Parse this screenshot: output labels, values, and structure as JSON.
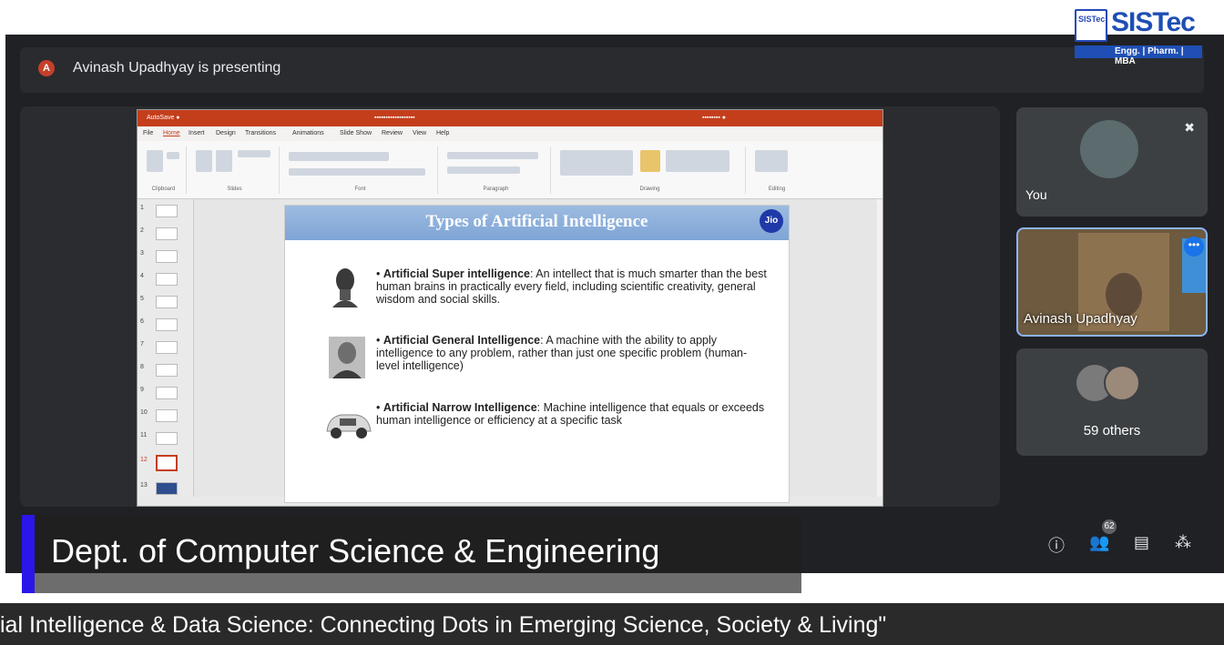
{
  "meet": {
    "presenting_initial": "A",
    "presenting_text": "Avinash Upadhyay is presenting"
  },
  "logo": {
    "badge": "SISTec",
    "name": "SISTec",
    "tagline": "Engg. | Pharm. | MBA"
  },
  "ppt": {
    "tabs": [
      "File",
      "Home",
      "Insert",
      "Design",
      "Transitions",
      "Animations",
      "Slide Show",
      "Review",
      "View",
      "Help"
    ],
    "ribbon_groups": [
      "Clipboard",
      "Slides",
      "Font",
      "Paragraph",
      "Drawing",
      "Editing"
    ],
    "thumb_numbers": [
      "1",
      "2",
      "3",
      "4",
      "5",
      "6",
      "7",
      "8",
      "9",
      "10",
      "11",
      "12",
      "13"
    ],
    "active_thumb": "12"
  },
  "slide": {
    "title": "Types of Artificial Intelligence",
    "logo": "Jio",
    "bullets": [
      {
        "term": "Artificial Super intelligence",
        "text": ": An intellect that is much smarter than the best human brains in practically every field, including scientific creativity, general wisdom and social skills."
      },
      {
        "term": "Artificial General Intelligence",
        "text": ": A machine with the ability to apply intelligence to any problem, rather than just one specific problem (human-level intelligence)"
      },
      {
        "term": "Artificial Narrow Intelligence",
        "text": ": Machine intelligence that equals or exceeds human intelligence or efficiency at a specific task"
      }
    ]
  },
  "participants": {
    "you_label": "You",
    "presenter_label": "Avinash Upadhyay",
    "others_label": "59 others",
    "people_count": "62"
  },
  "overlay": {
    "department": "Dept. of Computer Science & Engineering",
    "ticker": "ial Intelligence & Data Science: Connecting Dots in Emerging Science, Society & Living\""
  },
  "icons": [
    "info-icon",
    "people-icon",
    "chat-icon",
    "activities-icon",
    "mic-off-icon",
    "more-options-icon"
  ]
}
